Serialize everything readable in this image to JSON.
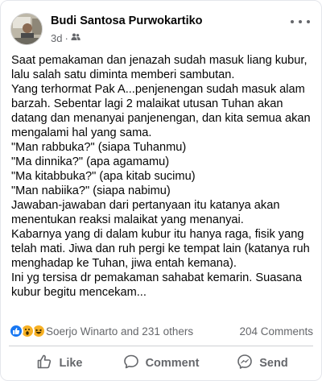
{
  "post": {
    "author": "Budi Santosa Purwokartiko",
    "time": "3d",
    "privacy_icon": "friends-icon",
    "paragraphs": [
      "Saat pemakaman dan jenazah sudah masuk liang kubur,",
      "lalu salah satu diminta memberi sambutan.",
      "Yang terhormat Pak A...penjenengan sudah masuk alam",
      "barzah. Sebentar lagi 2 malaikat utusan Tuhan akan",
      "datang dan menanyai panjenengan, dan kita semua akan",
      "mengalami hal yang sama.",
      "\"Man rabbuka?\" (siapa Tuhanmu)",
      "\"Ma dinnika?\" (apa agamamu)",
      "\"Ma kitabbuka?\" (apa kitab sucimu)",
      "\"Man nabiika?\" (siapa nabimu)",
      "Jawaban-jawaban dari pertanyaan itu katanya akan",
      "menentukan reaksi malaikat yang menanyai.",
      "Kabarnya yang di dalam kubur itu hanya raga, fisik yang",
      "telah mati. Jiwa dan ruh pergi ke tempat lain (katanya ruh",
      "menghadap ke Tuhan, jiwa entah kemana).",
      "Ini yg tersisa dr pemakaman sahabat kemarin. Suasana",
      "kubur begitu mencekam..."
    ]
  },
  "stats": {
    "reactions_text": "Soerjo Winarto and 231 others",
    "comments_text": "204 Comments",
    "reaction_icons": [
      "like-icon",
      "wow-icon",
      "haha-icon"
    ]
  },
  "actions": {
    "like": "Like",
    "comment": "Comment",
    "send": "Send"
  },
  "colors": {
    "primary_text": "#050505",
    "secondary_text": "#65676b",
    "like_blue": "#1877f2",
    "reaction_yellow": "#f7b125"
  }
}
